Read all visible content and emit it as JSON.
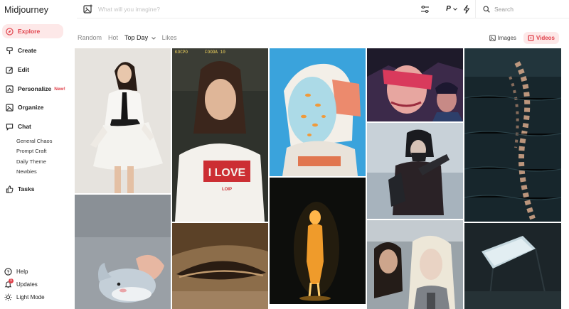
{
  "app": {
    "title": "Midjourney"
  },
  "nav": {
    "items": [
      {
        "label": "Explore",
        "icon": "compass-icon",
        "active": true
      },
      {
        "label": "Create",
        "icon": "brush-icon"
      },
      {
        "label": "Edit",
        "icon": "edit-icon"
      },
      {
        "label": "Personalize",
        "icon": "personalize-icon",
        "badge": "New!"
      },
      {
        "label": "Organize",
        "icon": "image-folder-icon"
      },
      {
        "label": "Chat",
        "icon": "chat-icon"
      }
    ],
    "chat_rooms": [
      "General Chaos",
      "Prompt Craft",
      "Daily Theme",
      "Newbies"
    ],
    "tasks": {
      "label": "Tasks",
      "icon": "thumbs-up-icon"
    },
    "bottom": [
      {
        "label": "Help",
        "icon": "help-icon"
      },
      {
        "label": "Updates",
        "icon": "bell-icon",
        "count": "1"
      },
      {
        "label": "Light Mode",
        "icon": "sun-icon"
      }
    ]
  },
  "topbar": {
    "prompt_placeholder": "What will you imagine?",
    "search_placeholder": "Search",
    "p_label": "P"
  },
  "filters": {
    "options": [
      "Random",
      "Hot",
      "Top Day",
      "Likes"
    ],
    "active": "Top Day"
  },
  "media_toggle": {
    "images_label": "Images",
    "videos_label": "Videos",
    "active": "Videos"
  },
  "grid": {
    "tiles": [
      {
        "name": "gallery-image-girl-white-dress"
      },
      {
        "name": "gallery-image-girl-love-shirt"
      },
      {
        "name": "gallery-image-astronaut-fish"
      },
      {
        "name": "gallery-image-anime-visor"
      },
      {
        "name": "gallery-image-ocean-night"
      },
      {
        "name": "gallery-image-whale-plush"
      },
      {
        "name": "gallery-image-eye-closeup"
      },
      {
        "name": "gallery-image-glowing-figure"
      },
      {
        "name": "gallery-image-warrior-woman"
      },
      {
        "name": "gallery-image-two-women"
      },
      {
        "name": "gallery-image-window-room"
      },
      {
        "name": "gallery-image-blue-strip"
      }
    ],
    "overlay_text": {
      "love_main": "I LOVE",
      "love_sub": "LOIP",
      "photo_stamp_left": "KOCPO",
      "photo_stamp_right": "FOODA 10"
    }
  }
}
